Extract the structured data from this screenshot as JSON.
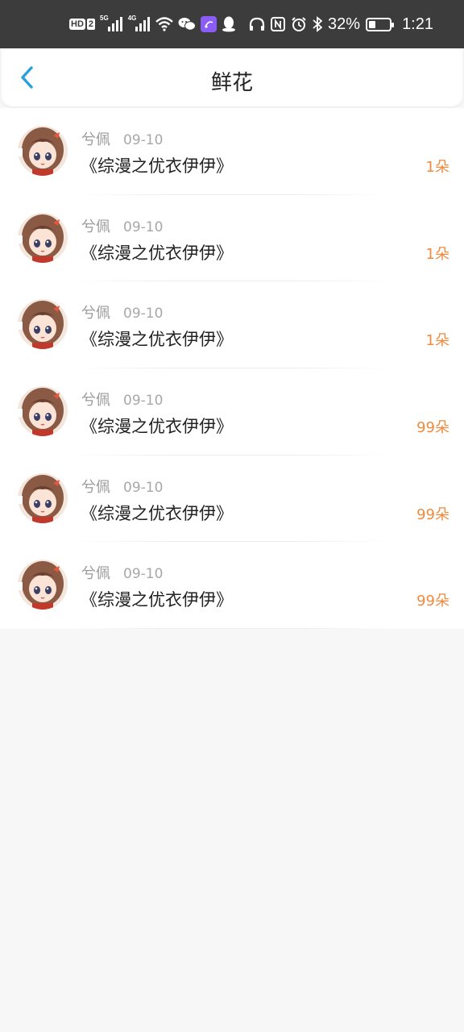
{
  "status_bar": {
    "hd_label": "HD",
    "hd_num": "2",
    "sig1_label": "5G",
    "sig2_label": "4G",
    "battery_percent": "32%",
    "battery_level": 0.32,
    "time": "1:21",
    "icons": [
      "hd-icon",
      "signal-5g-icon",
      "signal-4g-icon",
      "wifi-icon",
      "wechat-icon",
      "app-icon",
      "qq-icon",
      "headphones-icon",
      "nfc-icon",
      "alarm-icon",
      "bluetooth-icon",
      "battery-icon"
    ]
  },
  "header": {
    "back_icon": "chevron-left-icon",
    "title": "鲜花"
  },
  "colors": {
    "accent": "#2aa0de",
    "count": "#f08a3c",
    "status_bar_bg": "#3c3c3c",
    "page_bg": "#f8f7f7"
  },
  "items": [
    {
      "name": "兮佩",
      "date": "09-10",
      "book": "《综漫之优衣伊伊》",
      "count": "1朵"
    },
    {
      "name": "兮佩",
      "date": "09-10",
      "book": "《综漫之优衣伊伊》",
      "count": "1朵"
    },
    {
      "name": "兮佩",
      "date": "09-10",
      "book": "《综漫之优衣伊伊》",
      "count": "1朵"
    },
    {
      "name": "兮佩",
      "date": "09-10",
      "book": "《综漫之优衣伊伊》",
      "count": "99朵"
    },
    {
      "name": "兮佩",
      "date": "09-10",
      "book": "《综漫之优衣伊伊》",
      "count": "99朵"
    },
    {
      "name": "兮佩",
      "date": "09-10",
      "book": "《综漫之优衣伊伊》",
      "count": "99朵"
    }
  ]
}
